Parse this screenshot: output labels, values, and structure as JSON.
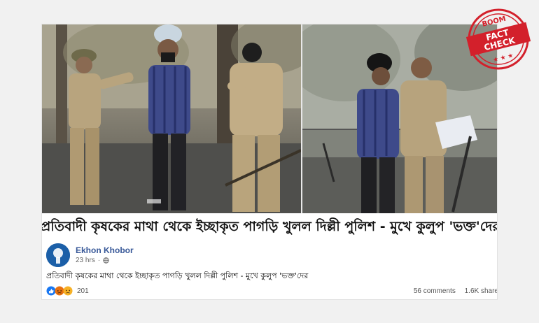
{
  "headline": "প্রতিবাদী কৃষকের মাথা থেকে ইচ্ছাকৃত পাগড়ি খুলল দিল্লী পুলিশ - মুখে কুলুপ 'ভক্ত'দের",
  "post": {
    "page_name": "Ekhon Khobor",
    "time": "23 hrs",
    "privacy_icon": "globe-icon",
    "text": "প্রতিবাদী কৃষকের মাথা থেকে ইচ্ছাকৃত পাগড়ি খুলল দিল্লী পুলিশ - মুখে কুলুপ 'ভক্ত'দের",
    "reactions": [
      "like-icon",
      "angry-icon",
      "sad-icon"
    ],
    "reaction_count": "201",
    "comments": "56 comments",
    "shares": "1.6K share"
  },
  "stamp": {
    "brand": "BOOM",
    "line1": "FACT",
    "line2": "CHECK",
    "color": "#d3202b"
  },
  "colors": {
    "link": "#385898",
    "accent": "#1877f2"
  }
}
